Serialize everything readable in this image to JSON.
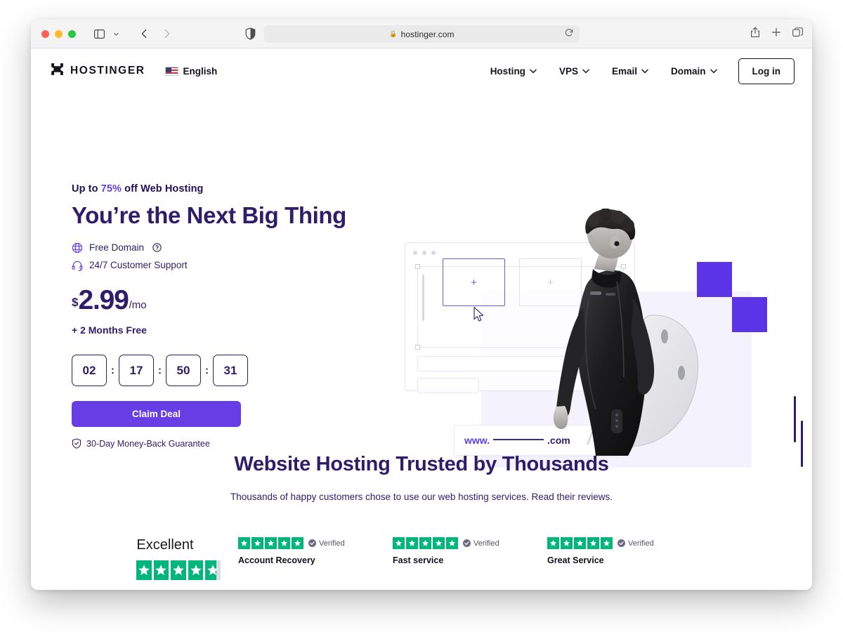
{
  "browser": {
    "url": "hostinger.com",
    "lock_icon": "lock-icon",
    "reload_icon": "reload-icon",
    "sidebar_icon": "sidebar-toggle-icon",
    "back_icon": "back-arrow-icon",
    "forward_icon": "forward-arrow-icon",
    "shield_icon": "privacy-shield-icon",
    "share_icon": "share-icon",
    "newtab_icon": "plus-icon",
    "tabs_icon": "tab-overview-icon"
  },
  "site": {
    "brand": "HOSTINGER",
    "language": "English",
    "nav": [
      {
        "label": "Hosting"
      },
      {
        "label": "VPS"
      },
      {
        "label": "Email"
      },
      {
        "label": "Domain"
      }
    ],
    "login_label": "Log in"
  },
  "hero": {
    "eyebrow_prefix": "Up to ",
    "eyebrow_pct": "75%",
    "eyebrow_suffix": " off Web Hosting",
    "headline": "You’re the Next Big Thing",
    "features": [
      {
        "icon": "globe-icon",
        "label": "Free Domain",
        "has_help": true
      },
      {
        "icon": "headset-icon",
        "label": "24/7 Customer Support",
        "has_help": false
      }
    ],
    "currency": "$",
    "amount": "2.99",
    "period": "/mo",
    "bonus": "+ 2 Months Free",
    "timer": {
      "days": "02",
      "hours": "17",
      "minutes": "50",
      "seconds": "31",
      "separator": ":"
    },
    "cta_label": "Claim Deal",
    "guarantee": "30-Day Money-Back Guarantee",
    "art": {
      "url_www": "www.",
      "url_tld": ".com",
      "placeholder_plus": "+"
    }
  },
  "trust": {
    "heading": "Website Hosting Trusted by Thousands",
    "subheading": "Thousands of happy customers chose to use our web hosting services. Read their reviews.",
    "trustpilot_label": "Excellent",
    "trustpilot_stars": 4.7,
    "verified_label": "Verified",
    "reviews": [
      {
        "title": "Account Recovery",
        "stars": 5
      },
      {
        "title": "Fast service",
        "stars": 5
      },
      {
        "title": "Great Service",
        "stars": 5
      }
    ]
  },
  "colors": {
    "brand_purple": "#673de6",
    "deep_indigo": "#2f1c6a",
    "square_purple": "#5c34e8",
    "trustpilot_green": "#00b67a"
  }
}
